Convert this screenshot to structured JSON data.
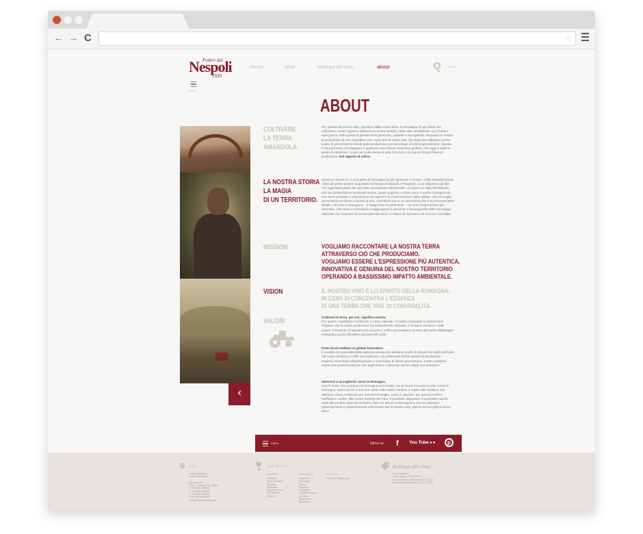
{
  "site": {
    "logo_top": "Poderi dal",
    "logo_main": "Nespoli",
    "logo_year": "1929"
  },
  "nav": {
    "items": [
      "home",
      "wine",
      "bottega del vino",
      "about"
    ],
    "active": "about",
    "search_placeholder": "cerca",
    "menu_label": "menu"
  },
  "main": {
    "title": "ABOUT",
    "sections": [
      {
        "label": "COLTIVARE\nLA TERRA\nAMANDOLA.",
        "text": "Per parlare del nostro vino, partiamo dalla nostra terra: la Romagna. È qui infatti che coltiviamo i nostri vigneti e abbiamo la nostra cantina, nella valle del Bidente. Qui viviamo ogni giorno, nello spirito di questa terra generosa, saporita e accogliente. Da quasi un secolo la produzione di vino scandisce con i suoi ritmi la nostra vita, ma negli anni abbiamo anche scelto di percorrere la strada della produzione con tecnologie di ultima generazione. Questo ci ha permesso di sviluppare e applicare una visione d'impresa globale, che oggi ci vede in grado di esportare i nostri vini sulle tavole di tutto il mondo e di coprire l'intera filiera di produzione.",
        "text_bold": "Dal vigneto al calice."
      },
      {
        "label": "LA NOSTRA STORIA\nLA MAGIA\nDI UN TERRITORIO.",
        "text": "Quasi un secolo fa, in una parte di Romagna tra gli Appennini e il mare, Attilio Ravaioli piantò i filari del primo podere acquistato nel borgo di Nespoli, il Prugneto, a cui seguirono gli altri che oggi fanno parte dei 110 ettari di proprietà dell'azienda. La zona è la Valle del Bidente, che ha caratteristiche territoriali uniche, quasi magiche, e dove unico è anche il sangiovese che viene prodotto. L'esposizione dei vigneti e la conformazione della vallata, che convoglia sul territorio un flusso costante di aria, contribuiscono a un microclima che è eccezionalmente ideale. I vini che ci ottengono – il sangiovese in particolare – ne sono l'espressione più autentica. Alla storia e al territorio si aggiungono il presente e l'avanguardia delle tecnologie utilizzate che muovono la nostra azienda verso un futuro di successo sul mercato mondiale."
      },
      {
        "label": "MISSION",
        "big": "VOGLIAMO RACCONTARE LA NOSTRA TERRA\nATTRAVERSO CIÒ CHE PRODUCIAMO.\nVOGLIAMO ESSERE L'ESPRESSIONE PIÙ AUTENTICA,\nINNOVATIVA E GENUINA DEL NOSTRO TERRITORIO\nOPERANDO A BASSISSIMO IMPATTO AMBIENTALE."
      },
      {
        "label": "VISION",
        "big": "IL NOSTRO VINO È LO SPIRITO DELLA ROMAGNA.\nIN ESSO SI CONCENTRA L'ESSENZA\nDI UNA TERRA CHE VIVE DI CONVIVIALITÀ."
      },
      {
        "label": "VALORI",
        "blocks": [
          {
            "title": "Coltivare la terra, per noi, significa amarla.",
            "text": "Per questo rispettiamo l'ambiente ci viene naturale. Ci siamo impegnati a minimizzare l'impatto che la nostra produzione ha sull'ambiente attuando il recupero termico e delle acque, e limitando l'inquinamento acustico. Inoltre provvediamo al 35% del nostro fabbisogno energetico grazie all'utilizzo dei pannelli solari."
          },
          {
            "title": "From local tradition to global innovation.",
            "text": "Il modello di imprenditorialità agricola privata che abbiamo scelto di attuare ha radici profonde nel nostro territorio e nelle sue tradizioni, ma contempla anche sistemi di produzione moderni, tecnologie all'avanguardia e macchinari di ultima generazione. Inoltre portiamo avanti una sperimentazione che applichiamo coltivando anche vitigni non autoctoni."
          },
          {
            "title": "Generosi e accoglienti, come la Romagna.",
            "text": "Con il nostro vino portiamo la Romagna nel mondo, ma se fosse il mondo a voler venire in Romagna, siamo pronti a ricevere visite nelle nostre cantine, e ospiti nelle strutture che abbiamo voluto realizzare per riceverli al meglio, come il \"gazebo\" per grandi eventi e l'anfiteatro. Inoltre, alla nostra Bottega del Vino, è possibile degustare e acquistare anche molti altri prodotti tipici del territorio, fatti con amore in Romagna e che noi abbiamo pazientemente e sapientemente selezionato per la nostra casa, aperta ad accogliere nuovi amici."
          }
        ]
      }
    ]
  },
  "bottom_bar": {
    "menu_label": "menu",
    "follow_label": "follow us:",
    "social": [
      "facebook-icon",
      "youtube-icon",
      "flickr-icon",
      "pinterest-icon"
    ],
    "youtube_text": "You Tube"
  },
  "footer": {
    "info": {
      "title": "info",
      "lines": "Azienda Agricola\nPoderi dal Nespoli\n\nVilla Rossi 50\n47012 - Nespoli (FC) - Italia\nT. +39 0543 989911\nF. +39 0543 989949\nE. +39 0543 990968\nP.IVA. 02170140406\ninfo@poderidalnespoli.com"
    },
    "wines": {
      "title": "our wines",
      "col1_head": "VINI ROSSI",
      "col1": "Il Nespoli\nBorgo dei Guidi\nPrugneto\nSantodeno\nNespolino Rosso\nFico Venato\nTalcinco",
      "col2_head": "VINI BIANCHI",
      "col2": "Gingheria\nDa Rioggio\nCortino\nRomaldo\nPoggiatello\nNespolino Bianco\nLa Corte\nMalaloduna\nMarzemino",
      "col3_head": "DISTILLATI",
      "col3": "Grappa di Sangiovese"
    },
    "bottega": {
      "title": "Bottega del Vino",
      "lines": "orari di apertura\nlunedì chiuso | 15:00/19:30\nda mercoledì a domenica 10:15 - 12:15\ndomenica sempre aperto 10:15 - 12:15"
    }
  },
  "colors": {
    "brand": "#8b1c2b",
    "muted": "#c9c1b8",
    "footer_bg": "#e7e4df"
  }
}
